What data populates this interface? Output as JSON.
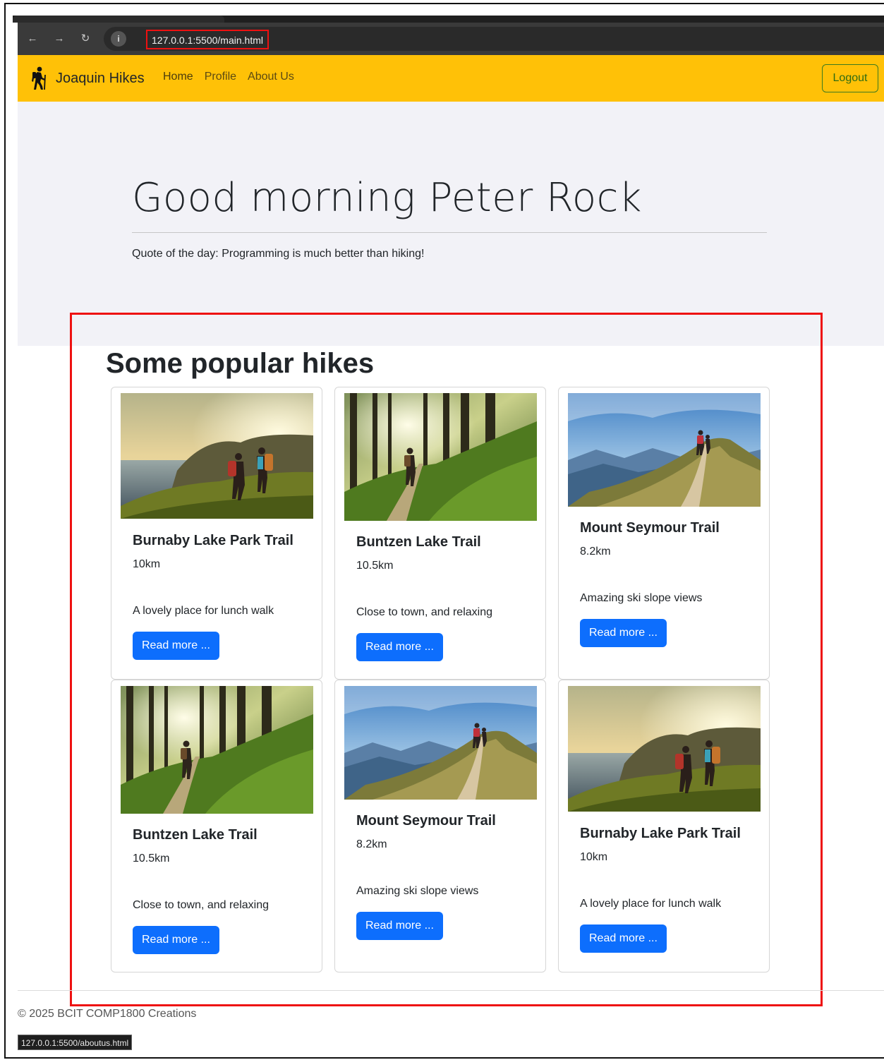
{
  "browser": {
    "url": "127.0.0.1:5500/main.html",
    "back_icon": "←",
    "forward_icon": "→",
    "reload_icon": "↻",
    "info_icon": "i"
  },
  "navbar": {
    "brand": "Joaquin Hikes",
    "links": [
      "Home",
      "Profile",
      "About Us"
    ],
    "logout": "Logout",
    "accent": "#ffc107"
  },
  "hero": {
    "title": "Good morning Peter Rock",
    "quote": "Quote of the day: Programming is much better than hiking!"
  },
  "section": {
    "title": "Some popular hikes"
  },
  "cards": [
    {
      "title": "Burnaby Lake Park Trail",
      "length": "10km",
      "description": "A lovely place for lunch walk",
      "button": "Read more ...",
      "image": "coast"
    },
    {
      "title": "Buntzen Lake Trail",
      "length": "10.5km",
      "description": "Close to town, and relaxing",
      "button": "Read more ...",
      "image": "forest"
    },
    {
      "title": "Mount Seymour Trail",
      "length": "8.2km",
      "description": "Amazing ski slope views",
      "button": "Read more ...",
      "image": "ridge"
    },
    {
      "title": "Buntzen Lake Trail",
      "length": "10.5km",
      "description": "Close to town, and relaxing",
      "button": "Read more ...",
      "image": "forest"
    },
    {
      "title": "Mount Seymour Trail",
      "length": "8.2km",
      "description": "Amazing ski slope views",
      "button": "Read more ...",
      "image": "ridge"
    },
    {
      "title": "Burnaby Lake Park Trail",
      "length": "10km",
      "description": "A lovely place for lunch walk",
      "button": "Read more ...",
      "image": "coast"
    }
  ],
  "footer": {
    "copyright": "© 2025 BCIT COMP1800 Creations"
  },
  "status_bar": {
    "hover_url": "127.0.0.1:5500/aboutus.html"
  },
  "colors": {
    "primary": "#0d6efd",
    "hero_bg": "#f2f2f7",
    "highlight": "#ee1111"
  }
}
